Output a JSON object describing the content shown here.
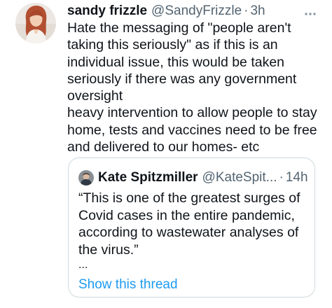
{
  "tweet": {
    "display_name": "sandy frizzle",
    "handle": "@SandyFrizzle",
    "separator": "·",
    "time": "3h",
    "more_icon": "more-horizontal-icon",
    "lines": [
      "Hate the messaging of \"people aren't",
      "taking this seriously\" as if this is an",
      "individual issue, this would be taken",
      "seriously if there was any government",
      "oversight",
      "heavy intervention to allow people to stay",
      "home, tests and vaccines need to be free",
      "and delivered to our homes- etc"
    ]
  },
  "quote": {
    "display_name": "Kate Spitzmiller",
    "handle": "@KateSpit...",
    "separator": "·",
    "time": "14h",
    "lines": [
      "“This is one of the greatest surges of",
      "Covid cases in the entire pandemic,",
      "according to wastewater analyses of",
      "the virus.”"
    ],
    "ellipsis": "...",
    "show_thread": "Show this thread"
  },
  "colors": {
    "text": "#0f1419",
    "secondary": "#536471",
    "link": "#1d9bf0",
    "border": "#cfd9de"
  }
}
